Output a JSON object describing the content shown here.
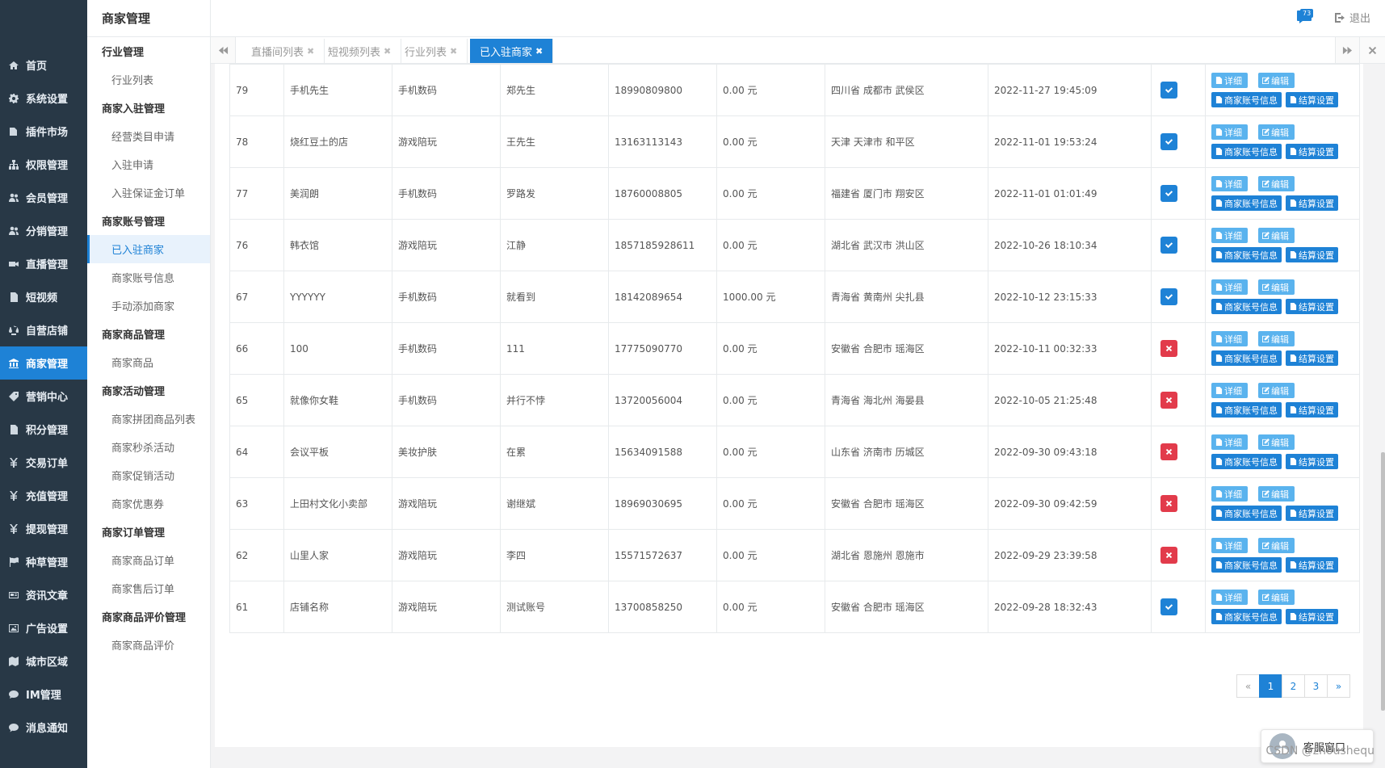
{
  "sidebar": {
    "items": [
      {
        "label": "首页",
        "icon": "home-icon"
      },
      {
        "label": "系统设置",
        "icon": "gear-icon"
      },
      {
        "label": "插件市场",
        "icon": "plugin-icon"
      },
      {
        "label": "权限管理",
        "icon": "sitemap-icon"
      },
      {
        "label": "会员管理",
        "icon": "users-icon"
      },
      {
        "label": "分销管理",
        "icon": "users-icon"
      },
      {
        "label": "直播管理",
        "icon": "video-icon"
      },
      {
        "label": "短视频",
        "icon": "file-icon"
      },
      {
        "label": "自营店铺",
        "icon": "balance-icon"
      },
      {
        "label": "商家管理",
        "icon": "bank-icon",
        "active": true
      },
      {
        "label": "营销中心",
        "icon": "tag-icon"
      },
      {
        "label": "积分管理",
        "icon": "file-icon"
      },
      {
        "label": "交易订单",
        "icon": "yen-icon"
      },
      {
        "label": "充值管理",
        "icon": "yen-icon"
      },
      {
        "label": "提现管理",
        "icon": "yen-icon"
      },
      {
        "label": "种草管理",
        "icon": "flag-icon"
      },
      {
        "label": "资讯文章",
        "icon": "newspaper-icon"
      },
      {
        "label": "广告设置",
        "icon": "image-icon"
      },
      {
        "label": "城市区域",
        "icon": "map-icon"
      },
      {
        "label": "IM管理",
        "icon": "chat-icon"
      },
      {
        "label": "消息通知",
        "icon": "comment-icon"
      }
    ]
  },
  "submenu": {
    "title": "商家管理",
    "entries": [
      {
        "type": "group",
        "label": "行业管理"
      },
      {
        "type": "item",
        "label": "行业列表"
      },
      {
        "type": "group",
        "label": "商家入驻管理"
      },
      {
        "type": "item",
        "label": "经营类目申请"
      },
      {
        "type": "item",
        "label": "入驻申请"
      },
      {
        "type": "item",
        "label": "入驻保证金订单"
      },
      {
        "type": "group",
        "label": "商家账号管理"
      },
      {
        "type": "item",
        "label": "已入驻商家",
        "active": true
      },
      {
        "type": "item",
        "label": "商家账号信息"
      },
      {
        "type": "item",
        "label": "手动添加商家"
      },
      {
        "type": "group",
        "label": "商家商品管理"
      },
      {
        "type": "item",
        "label": "商家商品"
      },
      {
        "type": "group",
        "label": "商家活动管理"
      },
      {
        "type": "item",
        "label": "商家拼团商品列表"
      },
      {
        "type": "item",
        "label": "商家秒杀活动"
      },
      {
        "type": "item",
        "label": "商家促销活动"
      },
      {
        "type": "item",
        "label": "商家优惠券"
      },
      {
        "type": "group",
        "label": "商家订单管理"
      },
      {
        "type": "item",
        "label": "商家商品订单"
      },
      {
        "type": "item",
        "label": "商家售后订单"
      },
      {
        "type": "group",
        "label": "商家商品评价管理"
      },
      {
        "type": "item",
        "label": "商家商品评价"
      }
    ]
  },
  "header": {
    "badge": "73",
    "logout": "退出"
  },
  "tabs": [
    {
      "label": "直播间列表",
      "close": "✖"
    },
    {
      "label": "短视频列表",
      "close": "✖"
    },
    {
      "label": "行业列表",
      "close": "✖"
    },
    {
      "label": "已入驻商家",
      "close": "✖",
      "active": true
    }
  ],
  "buttons": {
    "detail": "详细",
    "edit": "编辑",
    "account": "商家账号信息",
    "settle": "结算设置"
  },
  "rows": [
    {
      "id": "79",
      "name": "手机先生",
      "industry": "手机数码",
      "contact": "郑先生",
      "phone": "18990809800",
      "balance": "0.00 元",
      "region": "四川省 成都市 武侯区",
      "time": "2022-11-27 19:45:09",
      "enabled": true
    },
    {
      "id": "78",
      "name": "烧红豆土的店",
      "industry": "游戏陪玩",
      "contact": "王先生",
      "phone": "13163113143",
      "balance": "0.00 元",
      "region": "天津 天津市 和平区",
      "time": "2022-11-01 19:53:24",
      "enabled": true
    },
    {
      "id": "77",
      "name": "美润朗",
      "industry": "手机数码",
      "contact": "罗路发",
      "phone": "18760008805",
      "balance": "0.00 元",
      "region": "福建省 厦门市 翔安区",
      "time": "2022-11-01 01:01:49",
      "enabled": true
    },
    {
      "id": "76",
      "name": "韩衣馆",
      "industry": "游戏陪玩",
      "contact": "江静",
      "phone": "1857185928611",
      "balance": "0.00 元",
      "region": "湖北省 武汉市 洪山区",
      "time": "2022-10-26 18:10:34",
      "enabled": true
    },
    {
      "id": "67",
      "name": "YYYYYY",
      "industry": "手机数码",
      "contact": "就看到",
      "phone": "18142089654",
      "balance": "1000.00 元",
      "region": "青海省 黄南州 尖扎县",
      "time": "2022-10-12 23:15:33",
      "enabled": true
    },
    {
      "id": "66",
      "name": "100",
      "industry": "手机数码",
      "contact": "111",
      "phone": "17775090770",
      "balance": "0.00 元",
      "region": "安徽省 合肥市 瑶海区",
      "time": "2022-10-11 00:32:33",
      "enabled": false
    },
    {
      "id": "65",
      "name": "就像你女鞋",
      "industry": "手机数码",
      "contact": "并行不悖",
      "phone": "13720056004",
      "balance": "0.00 元",
      "region": "青海省 海北州 海晏县",
      "time": "2022-10-05 21:25:48",
      "enabled": false
    },
    {
      "id": "64",
      "name": "会议平板",
      "industry": "美妆护肤",
      "contact": "在累",
      "phone": "15634091588",
      "balance": "0.00 元",
      "region": "山东省 济南市 历城区",
      "time": "2022-09-30 09:43:18",
      "enabled": false
    },
    {
      "id": "63",
      "name": "上田村文化小卖部",
      "industry": "游戏陪玩",
      "contact": "谢继斌",
      "phone": "18969030695",
      "balance": "0.00 元",
      "region": "安徽省 合肥市 瑶海区",
      "time": "2022-09-30 09:42:59",
      "enabled": false
    },
    {
      "id": "62",
      "name": "山里人家",
      "industry": "游戏陪玩",
      "contact": "李四",
      "phone": "15571572637",
      "balance": "0.00 元",
      "region": "湖北省 恩施州 恩施市",
      "time": "2022-09-29 23:39:58",
      "enabled": false
    },
    {
      "id": "61",
      "name": "店铺名称",
      "industry": "游戏陪玩",
      "contact": "测试账号",
      "phone": "13700858250",
      "balance": "0.00 元",
      "region": "安徽省 合肥市 瑶海区",
      "time": "2022-09-28 18:32:43",
      "enabled": true
    }
  ],
  "pagination": {
    "prev": "«",
    "pages": [
      "1",
      "2",
      "3"
    ],
    "current": "1",
    "next": "»"
  },
  "support": {
    "label": "客服窗口"
  },
  "watermark": "CSDN @zhoushequ",
  "colors": {
    "primary": "#1e82d6",
    "danger": "#e23b4b",
    "sidebar": "#283846"
  }
}
